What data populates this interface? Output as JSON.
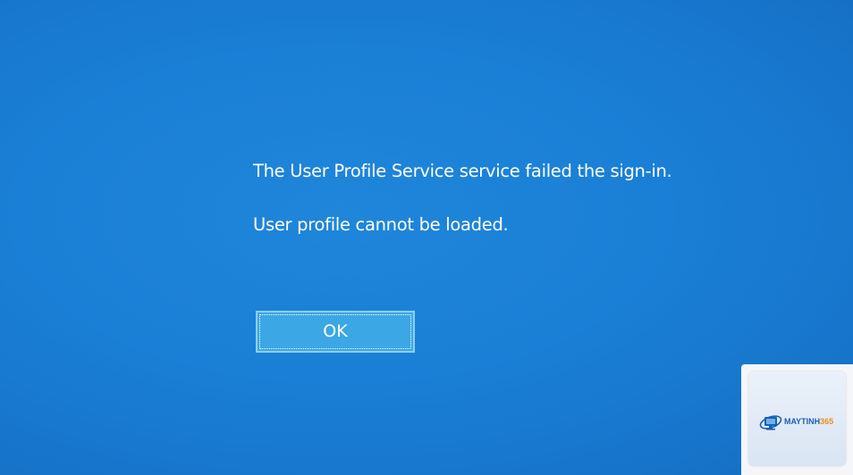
{
  "dialog": {
    "message_title": "The User Profile Service service failed the sign-in.",
    "message_detail": "User profile cannot be loaded.",
    "ok_label": "OK"
  },
  "watermark": {
    "brand_text": "MAYTINH",
    "brand_number": "365",
    "icon": "monitor-globe-icon"
  },
  "colors": {
    "background": "#1a7fd6",
    "button": "#3ba7e4",
    "text": "#ffffff"
  }
}
